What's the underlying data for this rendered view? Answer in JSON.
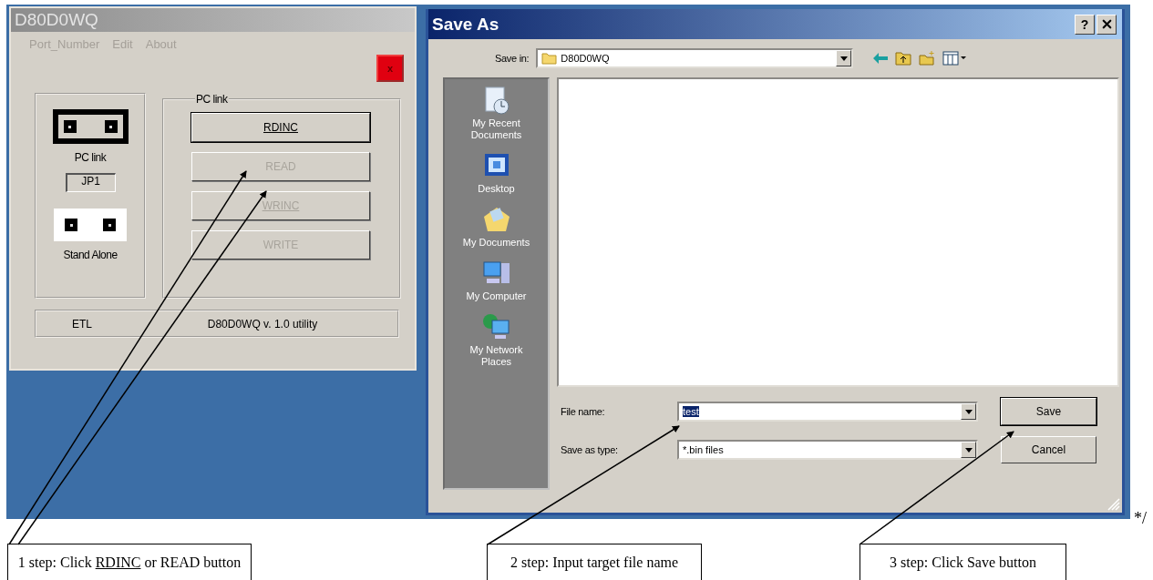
{
  "app_window": {
    "title": "D80D0WQ",
    "active": false,
    "menu": [
      {
        "label": "Port_Number",
        "disabled": true
      },
      {
        "label": "Edit",
        "disabled": true
      },
      {
        "label": "About",
        "disabled": true
      }
    ],
    "close_label": "x",
    "jumpers": [
      {
        "label": "PC link",
        "selected": true
      },
      {
        "label": "Stand Alone",
        "selected": false
      }
    ],
    "jumper_id": "JP1",
    "pc_link_group": {
      "title": "PC link",
      "buttons": [
        {
          "label": "RDINC",
          "disabled": false,
          "focused": true
        },
        {
          "label": "READ",
          "disabled": true,
          "focused": false
        },
        {
          "label": "WRINC",
          "disabled": true,
          "focused": true
        },
        {
          "label": "WRITE",
          "disabled": true,
          "focused": false
        }
      ]
    },
    "status_bar": [
      "ETL",
      "D80D0WQ v. 1.0 utility"
    ]
  },
  "save_dialog": {
    "title": "Save As",
    "help_label": "?",
    "save_in_label": "Save in:",
    "save_in_value": "D80D0WQ",
    "places": [
      {
        "label": "My Recent Documents",
        "kind": "recent"
      },
      {
        "label": "Desktop",
        "kind": "desktop"
      },
      {
        "label": "My Documents",
        "kind": "documents"
      },
      {
        "label": "My Computer",
        "kind": "computer"
      },
      {
        "label": "My Network Places",
        "kind": "network"
      }
    ],
    "file_name_label": "File name:",
    "file_name_value": "test",
    "file_name_selected": true,
    "type_label": "Save as type:",
    "type_value": "*.bin files",
    "buttons": [
      {
        "label": "Save",
        "default": true
      },
      {
        "label": "Cancel",
        "default": false
      }
    ]
  },
  "trailing_mark": "*/",
  "callouts": [
    {
      "parts": [
        {
          "text": "1 step: Click ",
          "underline": false
        },
        {
          "text": "RDINC",
          "underline": true
        },
        {
          "text": " or READ button",
          "underline": false
        }
      ]
    },
    {
      "parts": [
        {
          "text": "2 step: Input target file name",
          "underline": false
        }
      ]
    },
    {
      "parts": [
        {
          "text": "3 step: Click Save button",
          "underline": false
        }
      ]
    }
  ]
}
